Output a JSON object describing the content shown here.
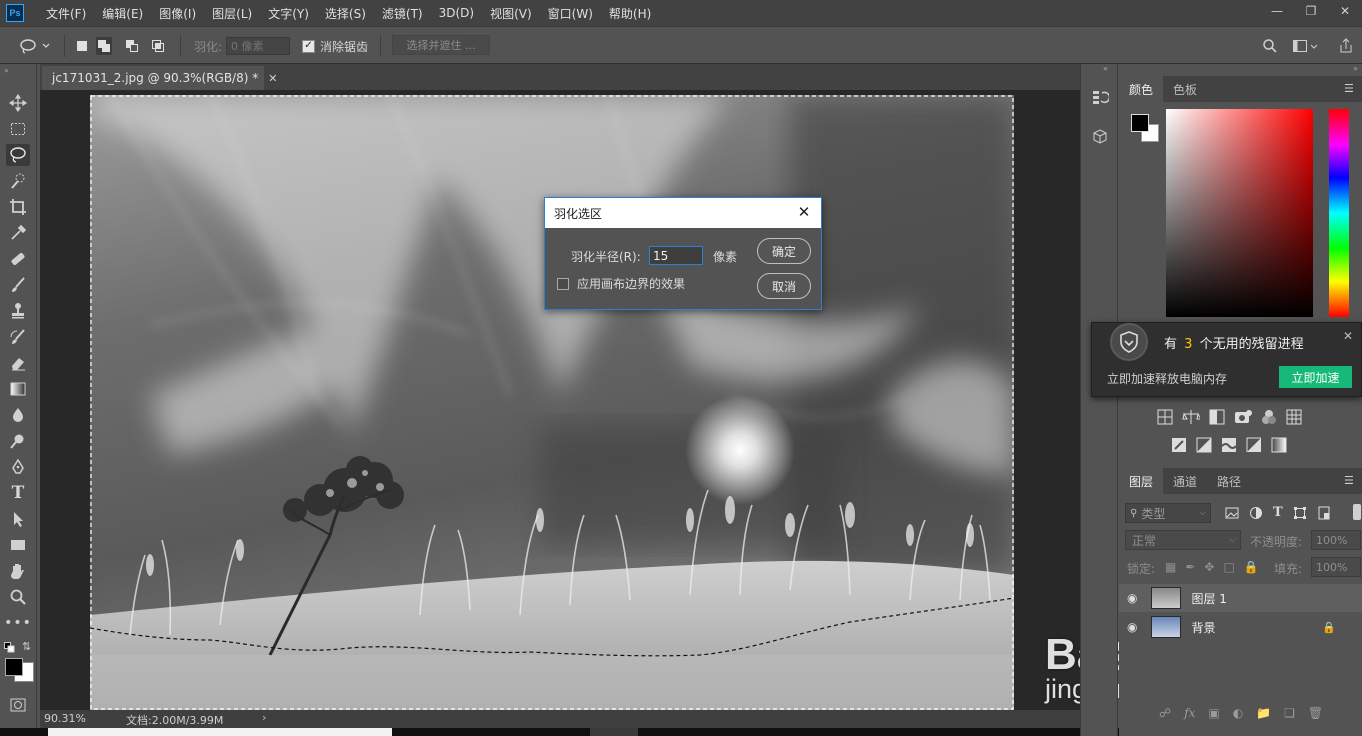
{
  "app": {
    "logo": "Ps"
  },
  "menu": [
    "文件(F)",
    "编辑(E)",
    "图像(I)",
    "图层(L)",
    "文字(Y)",
    "选择(S)",
    "滤镜(T)",
    "3D(D)",
    "视图(V)",
    "窗口(W)",
    "帮助(H)"
  ],
  "options": {
    "feather_label": "羽化:",
    "feather_placeholder": "0 像素",
    "antialias_label": "消除锯齿",
    "antialias_checked": true,
    "select_mask_label": "选择并遮住 ..."
  },
  "document": {
    "tab_title": "jc171031_2.jpg @ 90.3%(RGB/8) *",
    "zoom": "90.31%",
    "doc_info": "文档:2.00M/3.99M"
  },
  "dialog": {
    "title": "羽化选区",
    "radius_label": "羽化半径(R):",
    "radius_value": "15",
    "unit": "像素",
    "ok_label": "确定",
    "cancel_label": "取消",
    "apply_canvas_label": "应用画布边界的效果",
    "apply_canvas_checked": false
  },
  "color_panel": {
    "tabs": [
      "颜色",
      "色板"
    ],
    "foreground": "#000000",
    "background": "#ffffff"
  },
  "notification": {
    "prefix": "有",
    "count": "3",
    "suffix": "个无用的残留进程",
    "subtitle": "立即加速释放电脑内存",
    "button": "立即加速",
    "accent": "#ffcc00",
    "button_color": "#17b978"
  },
  "layers_panel": {
    "tabs": [
      "图层",
      "通道",
      "路径"
    ],
    "filter_label": "类型",
    "blend_mode": "正常",
    "opacity_label": "不透明度:",
    "opacity_value": "100%",
    "lock_label": "锁定:",
    "fill_label": "填充:",
    "fill_value": "100%",
    "layers": [
      {
        "name": "图层 1",
        "visible": true,
        "locked": false
      },
      {
        "name": "背景",
        "visible": true,
        "locked": true
      }
    ]
  },
  "watermark": {
    "brand": "Bai经验",
    "url": "jingyan.baidu.com"
  }
}
